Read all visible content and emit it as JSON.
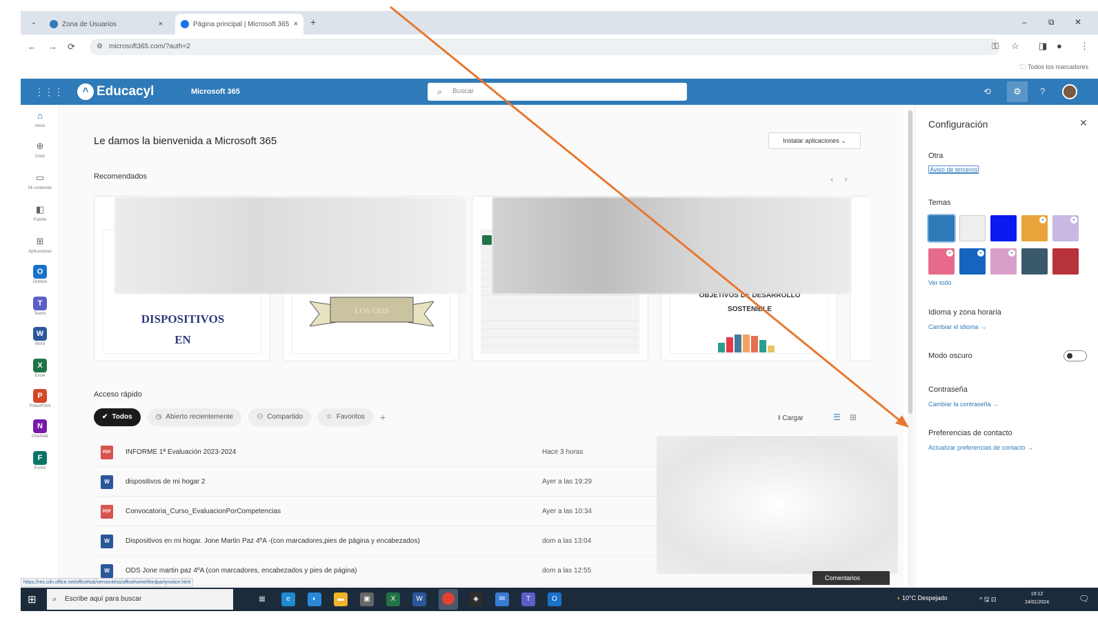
{
  "browser": {
    "tabs": [
      {
        "label": "Zona de Usuarios",
        "close": "×"
      },
      {
        "label": "Página principal | Microsoft 365",
        "close": "×"
      }
    ],
    "new_tab": "+",
    "tab_dropdown": "⌄",
    "window_controls": {
      "minimize": "–",
      "restore": "⧉",
      "close": "✕"
    },
    "nav": {
      "back": "←",
      "forward": "→",
      "reload": "⟳"
    },
    "url": "microsoft365.com/?auth=2",
    "bookmarks_label": "Todos los marcadores"
  },
  "header": {
    "brand": "Educacyl",
    "app_name": "Microsoft 365",
    "search_placeholder": "Buscar"
  },
  "rail": [
    {
      "label": "Inicio",
      "icon": "home-icon",
      "glyph": "⌂",
      "color": "#1f5e98"
    },
    {
      "label": "Crear",
      "icon": "create-icon",
      "glyph": "⊕",
      "color": "#666666"
    },
    {
      "label": "Mi contenido",
      "icon": "folder-icon",
      "glyph": "▭",
      "color": "#666666"
    },
    {
      "label": "Fuente",
      "icon": "feed-icon",
      "glyph": "◧",
      "color": "#666666"
    },
    {
      "label": "Aplicaciones",
      "icon": "apps-icon",
      "glyph": "⊞",
      "color": "#666666"
    },
    {
      "label": "Outlook",
      "icon": "outlook-icon",
      "glyph": "O",
      "color": "#1a73c8"
    },
    {
      "label": "Teams",
      "icon": "teams-icon",
      "glyph": "T",
      "color": "#5b5fc7"
    },
    {
      "label": "Word",
      "icon": "word-icon",
      "glyph": "W",
      "color": "#2b579a"
    },
    {
      "label": "Excel",
      "icon": "excel-icon",
      "glyph": "X",
      "color": "#217346"
    },
    {
      "label": "PowerPoint",
      "icon": "powerpoint-icon",
      "glyph": "P",
      "color": "#d24726"
    },
    {
      "label": "OneNote",
      "icon": "onenote-icon",
      "glyph": "N",
      "color": "#7719aa"
    },
    {
      "label": "Forms",
      "icon": "forms-icon",
      "glyph": "F",
      "color": "#077568"
    }
  ],
  "main": {
    "welcome": "Le damos la bienvenida a Microsoft 365",
    "install_button": "Instalar aplicaciones ⌄",
    "recommended_title": "Recomendados",
    "prev": "‹",
    "next": "›",
    "card1_text_line1": "DISPOSITIVOS",
    "card1_text_line2": "EN",
    "card2_ribbon": "LOS ODS",
    "card4_text_line1": "OBJETIVOS DE DESARROLLO",
    "card4_text_line2": "SOSTENIBLE",
    "quick_access_title": "Acceso rápido",
    "filters": [
      "Todos",
      "Abierto recientemente",
      "Compartido",
      "Favoritos"
    ],
    "add_filter": "+",
    "upload": "Cargar",
    "files": [
      {
        "name": "INFORME 1ª Evaluación 2023-2024",
        "date": "Hace 3 horas",
        "type": "PDF",
        "color": "#d9534f"
      },
      {
        "name": "dispositivos de mi hogar 2",
        "date": "Ayer a las 19:29",
        "type": "W",
        "color": "#2b579a"
      },
      {
        "name": "Convocatoria_Curso_EvaluacionPorCompetencias",
        "date": "Ayer a las 10:34",
        "type": "PDF",
        "color": "#d9534f"
      },
      {
        "name": "Dispositivos en mi hogar. Jone Martin Paz 4ºA -(con marcadores,pies de página y encabezados)",
        "date": "dom a las 13:04",
        "type": "W",
        "color": "#2b579a"
      },
      {
        "name": "ODS Jone martin paz 4ºA (con marcadores, encabezados y pies de página)",
        "date": "dom a las 12:55",
        "type": "W",
        "color": "#2b579a"
      }
    ],
    "comments_button": "Comentarios"
  },
  "settings": {
    "title": "Configuración",
    "close": "✕",
    "other_heading": "Otra",
    "third_party_link": "Aviso de terceros",
    "themes_heading": "Temas",
    "themes": [
      {
        "name": "theme-blue-selected",
        "color": "#2f7ab8",
        "add": false
      },
      {
        "name": "theme-light-gray",
        "color": "#eeeeee",
        "add": false
      },
      {
        "name": "theme-bright-blue",
        "color": "#0a1af0",
        "add": false
      },
      {
        "name": "theme-sunset",
        "color": "#e8a43a",
        "add": true
      },
      {
        "name": "theme-pastel",
        "color": "#c7b8e4",
        "add": true
      },
      {
        "name": "theme-colorful",
        "color": "#e86a8a",
        "add": true
      },
      {
        "name": "theme-dark-blue",
        "color": "#1565c0",
        "add": true
      },
      {
        "name": "theme-floral",
        "color": "#d8a0c8",
        "add": true
      },
      {
        "name": "theme-mountain",
        "color": "#3a5a6a",
        "add": false
      },
      {
        "name": "theme-red-city",
        "color": "#b8323a",
        "add": false
      }
    ],
    "see_all": "Ver todo",
    "language_heading": "Idioma y zona horaria",
    "language_link": "Cambiar el idioma →",
    "dark_mode_heading": "Modo oscuro",
    "password_heading": "Contraseña",
    "password_link": "Cambiar la contraseña →",
    "contact_heading": "Preferencias de contacto",
    "contact_link": "Actualizar preferencias de contacto →"
  },
  "status_url": "https://res.cdn.office.net/officehub/versionless/officehome/thirdpartynotice.html",
  "taskbar": {
    "search_placeholder": "Escribe aquí para buscar",
    "weather": "10°C Despejado",
    "tray": "^ 🖫 ⊡",
    "time": "19:12",
    "date": "24/01/2024"
  },
  "annotation_color": "#e8772e"
}
